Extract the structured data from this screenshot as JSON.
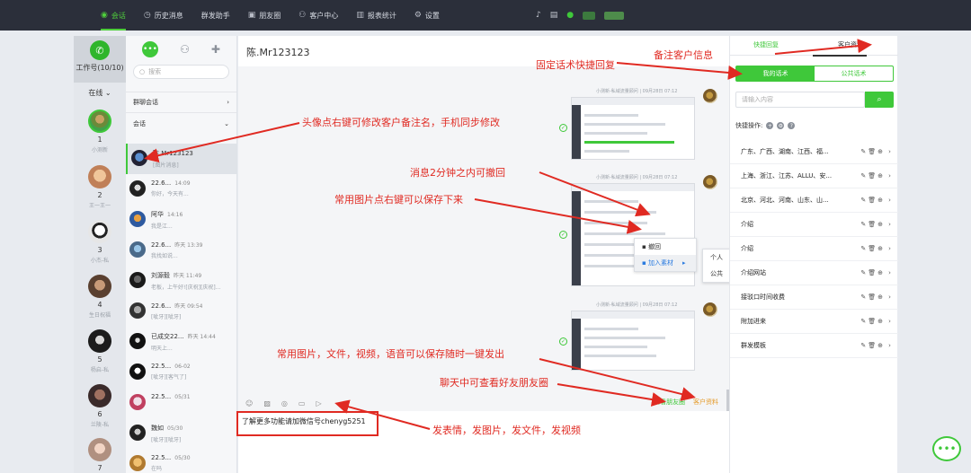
{
  "nav": {
    "items": [
      {
        "label": "会话",
        "icon": "chat-icon",
        "active": true
      },
      {
        "label": "历史消息",
        "icon": "clock-icon"
      },
      {
        "label": "群发助手",
        "icon": ""
      },
      {
        "label": "朋友圈",
        "icon": "moments-icon"
      },
      {
        "label": "客户中心",
        "icon": "users-icon"
      },
      {
        "label": "报表统计",
        "icon": "chart-icon"
      },
      {
        "label": "设置",
        "icon": "gear-icon"
      }
    ]
  },
  "accounts": {
    "header_label": "工作号(10/10)",
    "status_label": "在线",
    "list": [
      {
        "num": "1",
        "name": "小测新"
      },
      {
        "num": "2",
        "name": "王一王一"
      },
      {
        "num": "3",
        "name": "小杰-私"
      },
      {
        "num": "4",
        "name": "生日祝福"
      },
      {
        "num": "5",
        "name": "杨启-私"
      },
      {
        "num": "6",
        "name": "兰陵-私"
      },
      {
        "num": "7",
        "name": ""
      }
    ]
  },
  "chat_list": {
    "search_placeholder": "搜索",
    "group_label": "群聊会话",
    "section_label": "会话",
    "items": [
      {
        "name": "陈.Mr123123",
        "time": "",
        "msg": "[图片消息]"
      },
      {
        "name": "22.6...",
        "time": "14:09",
        "msg": "你好，今天有..."
      },
      {
        "name": "阿华",
        "time": "14:16",
        "msg": "我是江..."
      },
      {
        "name": "22.6...",
        "time": "昨天 13:39",
        "msg": "我找如说..."
      },
      {
        "name": "刘源毅",
        "time": "昨天 11:49",
        "msg": "老板，上午好![庆祝][庆祝]..."
      },
      {
        "name": "22.6...",
        "time": "昨天 09:54",
        "msg": "[呲牙][呲牙]"
      },
      {
        "name": "已成交22...",
        "time": "昨天 14:44",
        "msg": "明天上..."
      },
      {
        "name": "22.5...",
        "time": "06-02",
        "msg": "[呲牙][客气了]"
      },
      {
        "name": "22.5...",
        "time": "05/31",
        "msg": ""
      },
      {
        "name": "魏如",
        "time": "05/30",
        "msg": "[呲牙][呲牙]"
      },
      {
        "name": "22.5...",
        "time": "05/30",
        "msg": "在吗"
      }
    ]
  },
  "main": {
    "title": "陈.Mr123123",
    "messages": [
      {
        "meta": "小测新-私域流量顾问 | 09月28日 07:12"
      },
      {
        "meta": "小测新-私域流量顾问 | 09月28日 07:12"
      },
      {
        "meta": "小测新-私域流量顾问 | 09月28日 07:12"
      }
    ],
    "context_menu": {
      "recall": "撤回",
      "add_material": "加入素材",
      "personal": "个人",
      "public": "公共"
    },
    "input_text": "了解更多功能请加微信号chenyg5251",
    "view_moments": "查看朋友圈",
    "materials": "客户资料"
  },
  "right_panel": {
    "tab_quick_reply": "快捷回复",
    "tab_customer_info": "客户资料",
    "seg_mine": "我的话术",
    "seg_public": "公共话术",
    "search_placeholder": "请输入内容",
    "quick_ops_label": "快捷操作:",
    "items": [
      "广东、广西、湖南、江西、福...",
      "上海、浙江、江苏、ALLU、安...",
      "北京、河北、河南、山东、山...",
      "介绍",
      "介绍",
      "介绍网站",
      "接驳口时间收费",
      "附加进来",
      "群发模板"
    ]
  },
  "annotations": {
    "a1": "备注客户信息",
    "a2": "固定话术快捷回复",
    "a3": "头像点右键可修改客户备注名，手机同步修改",
    "a4": "消息2分钟之内可撤回",
    "a5": "常用图片点右键可以保存下来",
    "a6": "常用图片，文件，视频，语音可以保存随时一键发出",
    "a7": "聊天中可查看好友朋友圈",
    "a8": "发表情，发图片，发文件，发视频"
  },
  "colors": {
    "accent": "#3fc83a",
    "topbar": "#2b2f3a",
    "annotation": "#e02a22"
  }
}
